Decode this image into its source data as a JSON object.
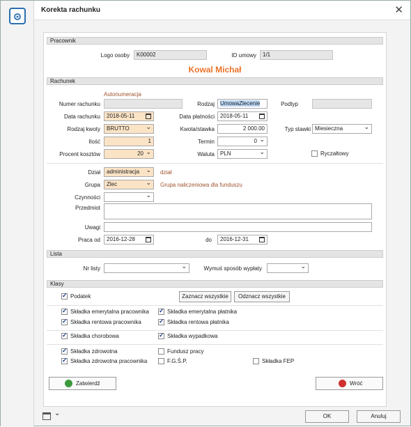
{
  "window": {
    "title": "Korekta rachunku"
  },
  "pracownik": {
    "section_label": "Pracownik",
    "logo_label": "Logo osoby",
    "logo_value": "K00002",
    "id_label": "ID umowy",
    "id_value": "1/1",
    "name": "Kowal Michał"
  },
  "rachunek": {
    "section_label": "Rachunek",
    "autonumeracja": "Autonumeracja",
    "numer_label": "Numer rachunku",
    "rodzaj_label": "Rodzaj",
    "rodzaj_value": "UmowaZlecenie",
    "podtyp_label": "Podtyp",
    "data_rach_label": "Data rachunku",
    "data_rach_value": "2018-05-11",
    "data_plat_label": "Data płatności",
    "data_plat_value": "2018-05-11",
    "rodzaj_kwoty_label": "Rodzaj kwoty",
    "rodzaj_kwoty_value": "BRUTTO",
    "kwota_label": "Kwota/stawka",
    "kwota_value": "2 000.00",
    "typ_stawki_label": "Typ stawki",
    "typ_stawki_value": "Miesieczna",
    "ilosc_label": "Ilość",
    "ilosc_value": "1",
    "termin_label": "Termin",
    "termin_value": "0",
    "procent_label": "Procent kosztów",
    "procent_value": "20",
    "waluta_label": "Waluta",
    "waluta_value": "PLN",
    "ryczaltowy_label": "Ryczałtowy",
    "dzial_label": "Dział",
    "dzial_value": "administracja",
    "dzial_note": "dział",
    "grupa_label": "Grupa",
    "grupa_value": "Zlec",
    "grupa_note": "Grupa naliczeniowa dla funduszu",
    "czynnosci_label": "Czynności",
    "przedmiot_label": "Przedmiot",
    "uwagi_label": "Uwagi",
    "praca_od_label": "Praca od",
    "praca_od_value": "2016-12-28",
    "do_label": "do",
    "do_value": "2016-12-31"
  },
  "lista": {
    "section_label": "Lista",
    "nr_listy_label": "Nr listy",
    "wymus_label": "Wymuś sposób wypłaty"
  },
  "klasy": {
    "section_label": "Klasy",
    "podatek": "Podatek",
    "zaznacz": "Zaznacz wszystkie",
    "odznacz": "Odznacz wszystkie",
    "em_prac": "Składka emerytalna pracownika",
    "em_plat": "Składka emerytalna płatnika",
    "rent_prac": "Składka rentowa pracownika",
    "rent_plat": "Składka rentowa płatnika",
    "chorobowa": "Składka chorobowa",
    "wypadkowa": "Składka wypadkowa",
    "zdrowotna": "Składka zdrowotna",
    "fundusz": "Fundusz pracy",
    "zdrow_prac": "Składka zdrowotna pracownika",
    "fgsp": "F.G.Ś.P.",
    "fep": "Składka FEP"
  },
  "actions": {
    "zatwierdz": "Zatwierdź",
    "wroc": "Wróć",
    "ok": "OK",
    "anuluj": "Anuluj"
  },
  "colors": {
    "accent_orange": "#e8742a",
    "note_brown": "#a0522d",
    "ok_green": "#3a9a3a",
    "back_red": "#d03030"
  }
}
